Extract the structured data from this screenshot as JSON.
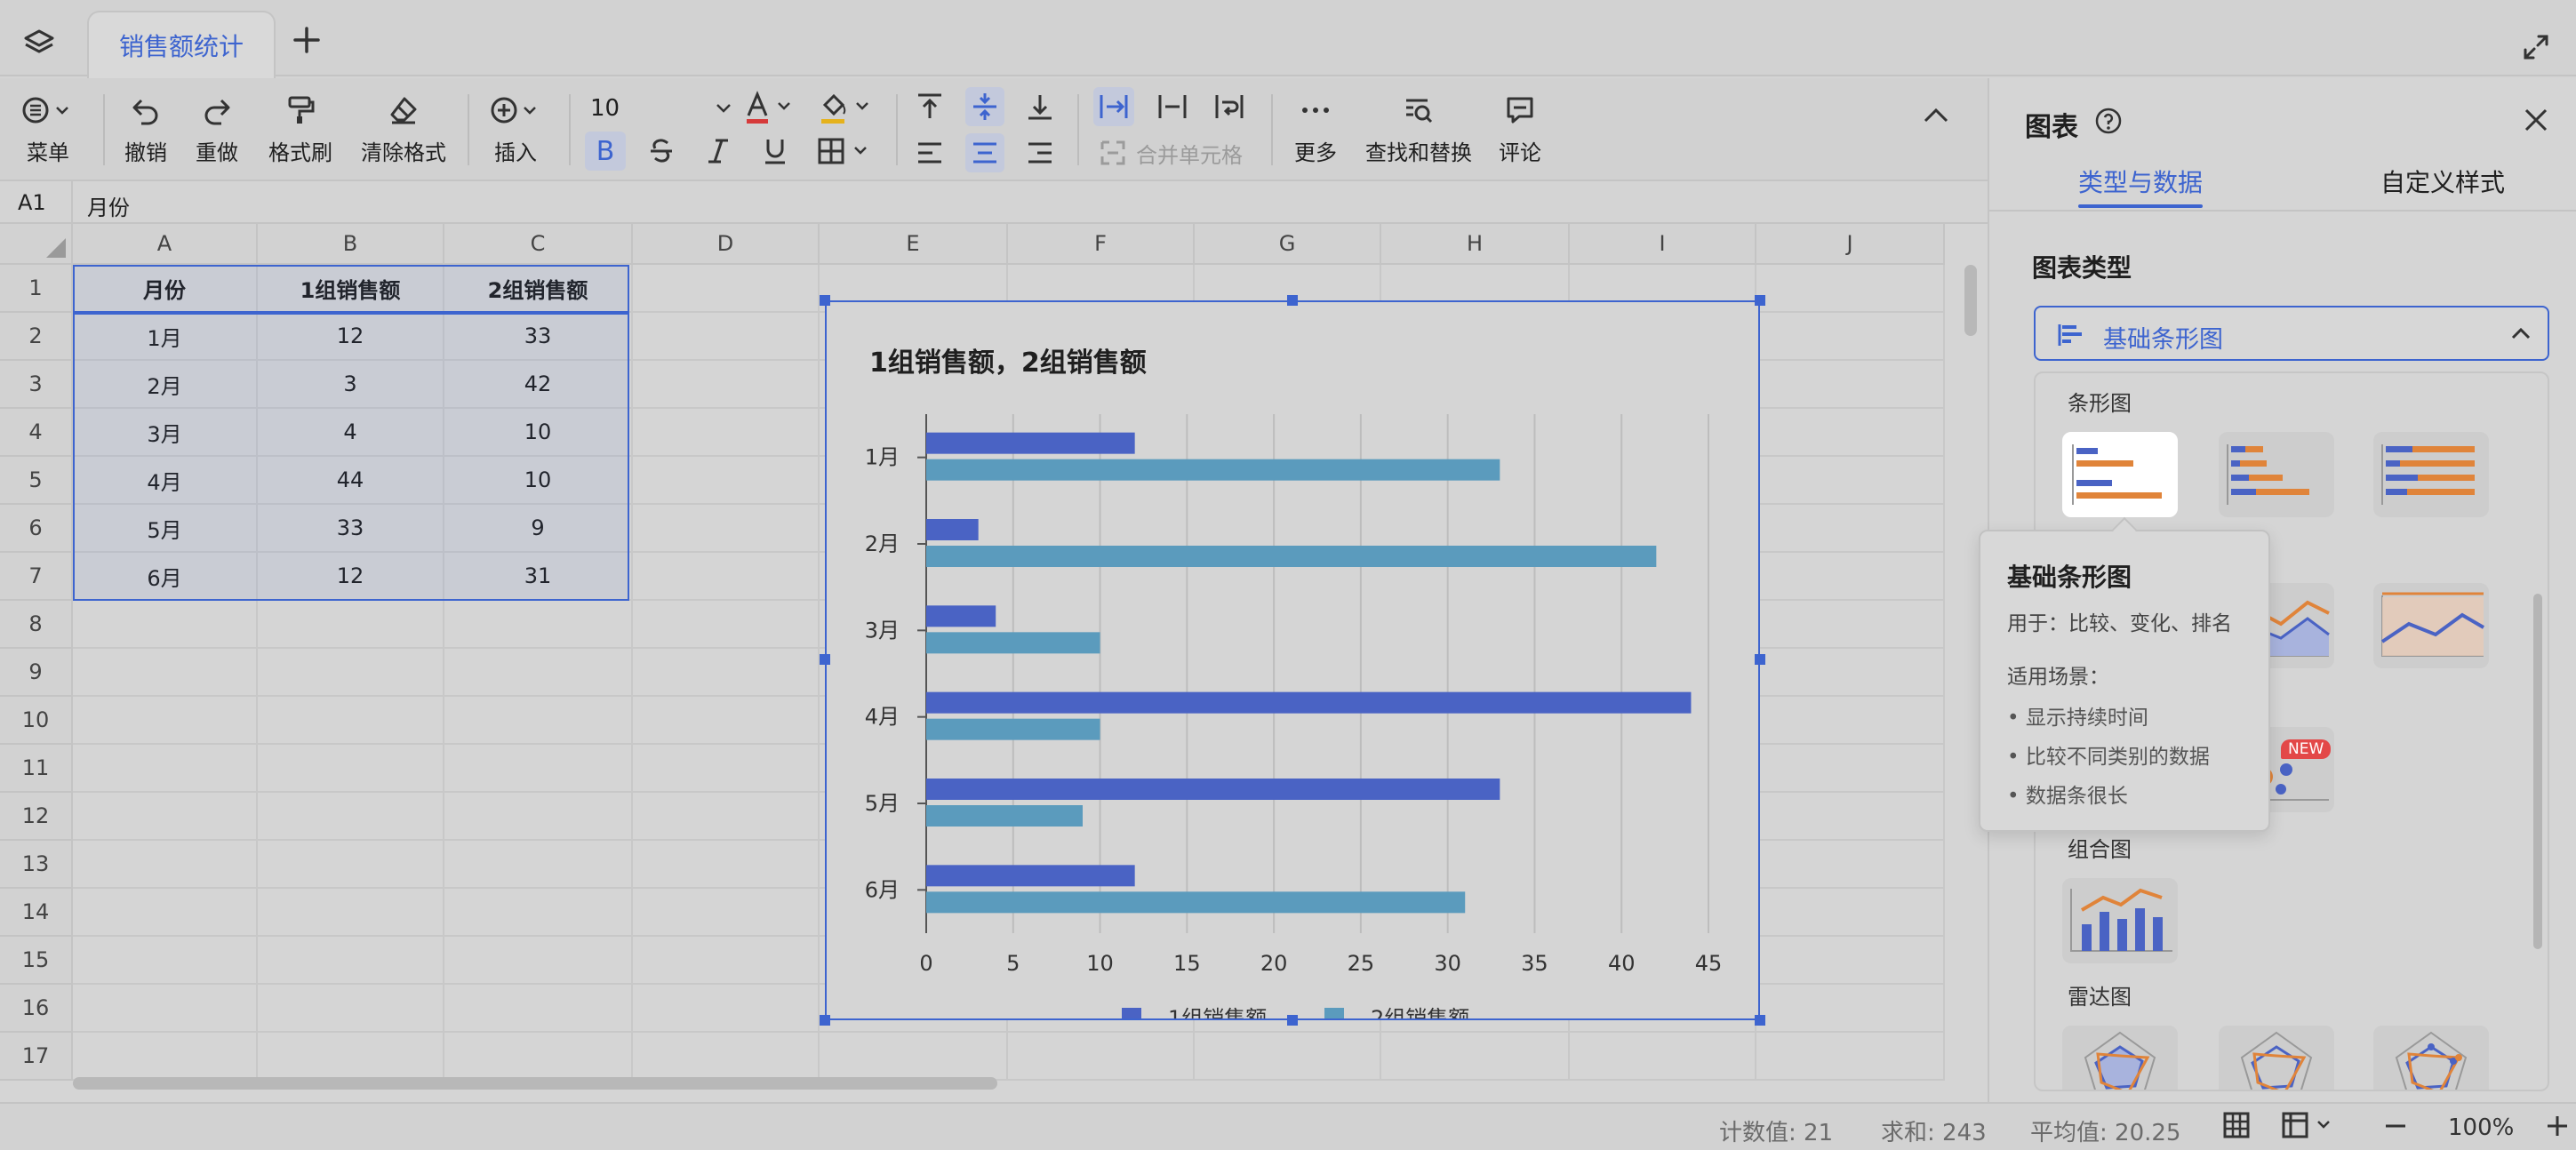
{
  "titlebar": {
    "doc_tab": "销售额统计"
  },
  "toolbar": {
    "menu": "菜单",
    "undo": "撤销",
    "redo": "重做",
    "format_painter": "格式刷",
    "clear_format": "清除格式",
    "insert": "插入",
    "font_size": "10",
    "bold": "B",
    "merge_cells": "合并单元格",
    "more": "更多",
    "find_replace": "查找和替换",
    "comment": "评论"
  },
  "formula_bar": {
    "cell_ref": "A1",
    "value": "月份"
  },
  "sheet": {
    "columns": [
      "A",
      "B",
      "C",
      "D",
      "E",
      "F",
      "G",
      "H",
      "I",
      "J"
    ],
    "rows": [
      "1",
      "2",
      "3",
      "4",
      "5",
      "6",
      "7",
      "8",
      "9",
      "10",
      "11",
      "12",
      "13",
      "14",
      "15",
      "16",
      "17"
    ],
    "header": [
      "月份",
      "1组销售额",
      "2组销售额"
    ],
    "data": [
      [
        "1月",
        "12",
        "33"
      ],
      [
        "2月",
        "3",
        "42"
      ],
      [
        "3月",
        "4",
        "10"
      ],
      [
        "4月",
        "44",
        "10"
      ],
      [
        "5月",
        "33",
        "9"
      ],
      [
        "6月",
        "12",
        "31"
      ]
    ]
  },
  "chart_data": {
    "type": "bar",
    "orientation": "horizontal",
    "title": "1组销售额，2组销售额",
    "categories": [
      "1月",
      "2月",
      "3月",
      "4月",
      "5月",
      "6月"
    ],
    "series": [
      {
        "name": "1组销售额",
        "values": [
          12,
          3,
          4,
          44,
          33,
          12
        ],
        "color": "#4a63c4"
      },
      {
        "name": "2组销售额",
        "values": [
          33,
          42,
          10,
          10,
          9,
          31
        ],
        "color": "#5b9bbd"
      }
    ],
    "xlim": [
      0,
      45
    ],
    "xticks": [
      "0",
      "5",
      "10",
      "15",
      "20",
      "25",
      "30",
      "35",
      "40",
      "45"
    ],
    "grid": true,
    "legend_position": "bottom"
  },
  "statusbar": {
    "count": "计数值: 21",
    "sum": "求和: 243",
    "avg": "平均值: 20.25",
    "zoom": "100%"
  },
  "panel": {
    "title": "图表",
    "tab_type": "类型与数据",
    "tab_style": "自定义样式",
    "section_type": "图表类型",
    "selected_type": "基础条形图",
    "groups": {
      "bar": "条形图",
      "combo": "组合图",
      "radar": "雷达图"
    },
    "new_badge": "NEW"
  },
  "tooltip": {
    "title": "基础条形图",
    "usage": "用于：比较、变化、排名",
    "scene_label": "适用场景：",
    "items": [
      "• 显示持续时间",
      "• 比较不同类别的数据",
      "• 数据条很长"
    ]
  },
  "colors": {
    "accent": "#3d64cf",
    "orange": "#e0843a",
    "series1": "#4a63c4",
    "series2": "#5b9bbd"
  }
}
